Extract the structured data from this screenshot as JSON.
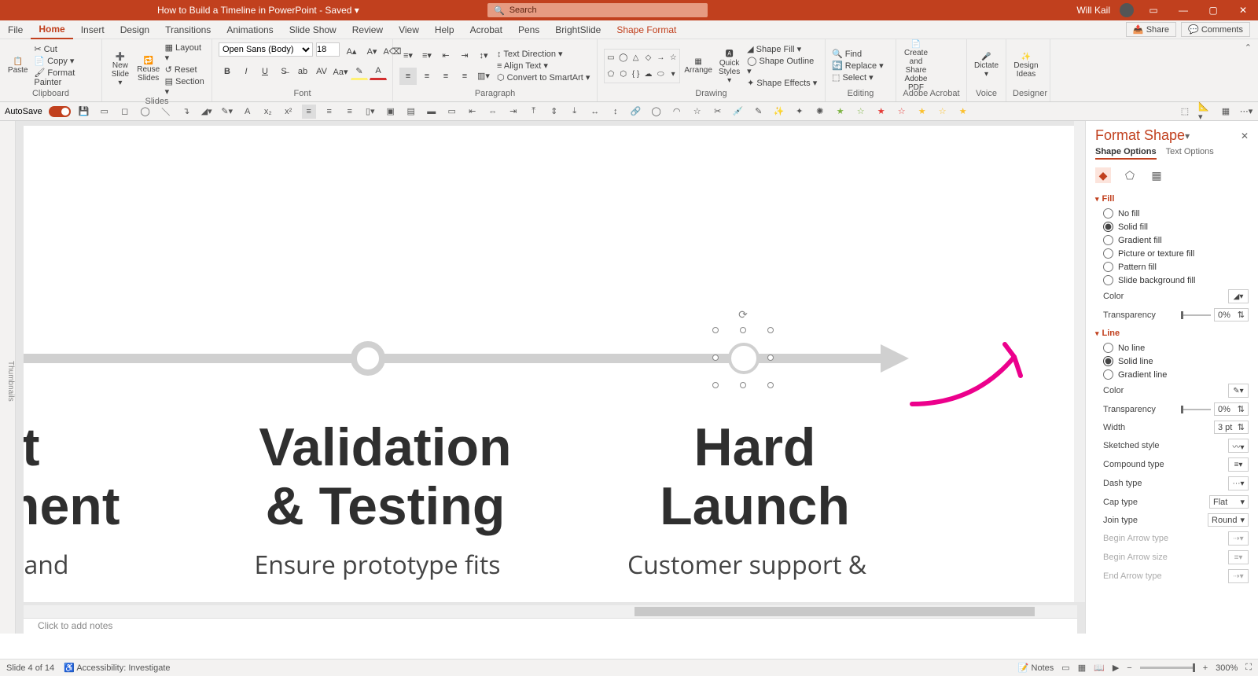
{
  "titlebar": {
    "title": "How to Build a Timeline in PowerPoint  -  Saved ▾",
    "search_placeholder": "Search",
    "user": "Will Kail"
  },
  "tabs": {
    "items": [
      "File",
      "Home",
      "Insert",
      "Design",
      "Transitions",
      "Animations",
      "Slide Show",
      "Review",
      "View",
      "Help",
      "Acrobat",
      "Pens",
      "BrightSlide",
      "Shape Format"
    ],
    "active": "Home",
    "share": "Share",
    "comments": "Comments"
  },
  "ribbon": {
    "clipboard": {
      "paste": "Paste",
      "cut": "Cut",
      "copy": "Copy ▾",
      "format_painter": "Format Painter",
      "label": "Clipboard"
    },
    "slides": {
      "new_slide": "New Slide ▾",
      "reuse": "Reuse Slides",
      "layout": "Layout ▾",
      "reset": "Reset",
      "section": "Section ▾",
      "label": "Slides"
    },
    "font": {
      "name": "Open Sans (Body)",
      "size": "18",
      "label": "Font"
    },
    "paragraph": {
      "text_direction": "Text Direction ▾",
      "align_text": "Align Text ▾",
      "smartart": "Convert to SmartArt ▾",
      "label": "Paragraph"
    },
    "drawing": {
      "arrange": "Arrange",
      "quick_styles": "Quick Styles ▾",
      "shape_fill": "Shape Fill ▾",
      "shape_outline": "Shape Outline ▾",
      "shape_effects": "Shape Effects ▾",
      "label": "Drawing"
    },
    "editing": {
      "find": "Find",
      "replace": "Replace ▾",
      "select": "Select ▾",
      "label": "Editing"
    },
    "adobe": {
      "btn": "Create and Share Adobe PDF",
      "label": "Adobe Acrobat"
    },
    "voice": {
      "btn": "Dictate ▾",
      "label": "Voice"
    },
    "designer": {
      "btn": "Design Ideas",
      "label": "Designer"
    }
  },
  "quickrow": {
    "autosave": "AutoSave"
  },
  "slide": {
    "h1a": "ct",
    "h1b": "ment",
    "h2a": "Validation",
    "h2b": "& Testing",
    "h3a": "Hard",
    "h3b": "Launch",
    "s1": "ck and",
    "s2": "Ensure prototype fits",
    "s3": "Customer support &"
  },
  "notes": {
    "placeholder": "Click to add notes"
  },
  "pane": {
    "title": "Format Shape",
    "tabs": {
      "shape": "Shape Options",
      "text": "Text Options"
    },
    "fill": {
      "label": "Fill",
      "no_fill": "No fill",
      "solid_fill": "Solid fill",
      "gradient_fill": "Gradient fill",
      "picture_fill": "Picture or texture fill",
      "pattern_fill": "Pattern fill",
      "slide_bg": "Slide background fill",
      "color": "Color",
      "transparency": "Transparency",
      "transparency_val": "0%"
    },
    "line": {
      "label": "Line",
      "no_line": "No line",
      "solid_line": "Solid line",
      "gradient_line": "Gradient line",
      "color": "Color",
      "transparency": "Transparency",
      "transparency_val": "0%",
      "width": "Width",
      "width_val": "3 pt",
      "sketched": "Sketched style",
      "compound": "Compound type",
      "dash": "Dash type",
      "cap": "Cap type",
      "cap_val": "Flat",
      "join": "Join type",
      "join_val": "Round",
      "begin_arrow": "Begin Arrow type",
      "begin_size": "Begin Arrow size",
      "end_arrow": "End Arrow type"
    }
  },
  "status": {
    "slide": "Slide 4 of 14",
    "accessibility": "Accessibility: Investigate",
    "notes": "Notes",
    "zoom": "300%"
  }
}
